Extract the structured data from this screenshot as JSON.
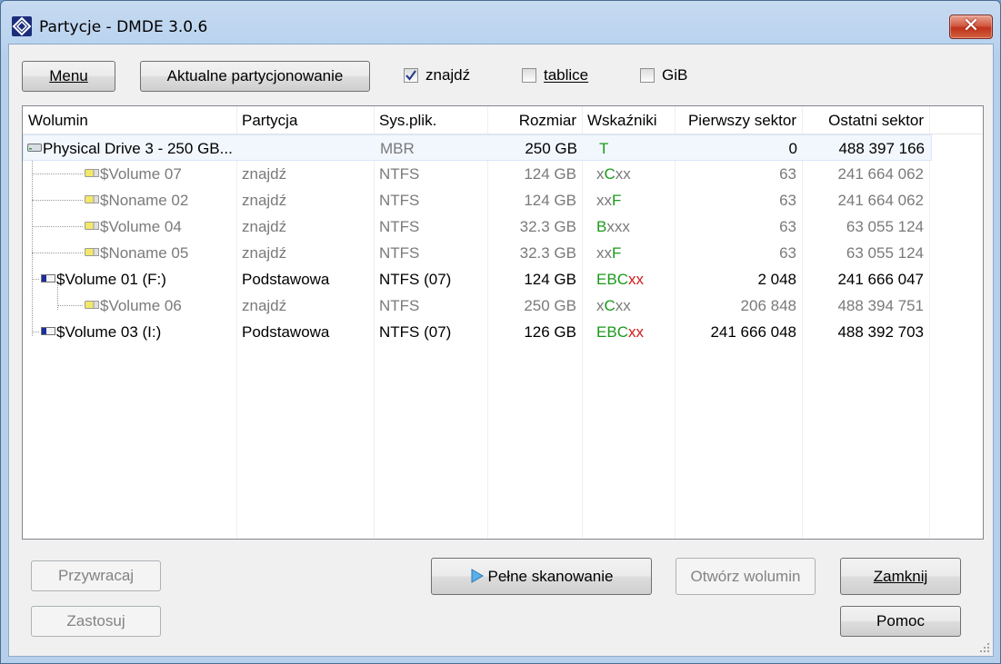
{
  "window": {
    "title": "Partycje - DMDE 3.0.6"
  },
  "toolbar": {
    "menu_label": "Menu",
    "current_partitioning_label": "Aktualne partycjonowanie",
    "checkbox_find": {
      "label": "znajdź",
      "checked": true
    },
    "checkbox_tables": {
      "label": "tablice",
      "checked": false
    },
    "checkbox_gib": {
      "label": "GiB",
      "checked": false
    }
  },
  "table": {
    "columns": [
      "Wolumin",
      "Partycja",
      "Sys.plik.",
      "Rozmiar",
      "Wskaźniki",
      "Pierwszy sektor",
      "Ostatni sektor"
    ],
    "rows": [
      {
        "name": "Physical Drive 3 - 250 GB...",
        "partition": "",
        "fs": "MBR",
        "size": "250 GB",
        "flags": "T",
        "first": "0",
        "last": "488 397 166"
      },
      {
        "name": "$Volume 07",
        "partition": "znajdź",
        "fs": "NTFS",
        "size": "124 GB",
        "flags": "xCxx",
        "first": "63",
        "last": "241 664 062"
      },
      {
        "name": "$Noname 02",
        "partition": "znajdź",
        "fs": "NTFS",
        "size": "124 GB",
        "flags": "xxF",
        "first": "63",
        "last": "241 664 062"
      },
      {
        "name": "$Volume 04",
        "partition": "znajdź",
        "fs": "NTFS",
        "size": "32.3 GB",
        "flags": "Bxxx",
        "first": "63",
        "last": "63 055 124"
      },
      {
        "name": "$Noname 05",
        "partition": "znajdź",
        "fs": "NTFS",
        "size": "32.3 GB",
        "flags": "xxF",
        "first": "63",
        "last": "63 055 124"
      },
      {
        "name": "$Volume 01 (F:)",
        "partition": "Podstawowa",
        "fs": "NTFS (07)",
        "size": "124 GB",
        "flags": "EBCxx",
        "first": "2 048",
        "last": "241 666 047"
      },
      {
        "name": "$Volume 06",
        "partition": "znajdź",
        "fs": "NTFS",
        "size": "250 GB",
        "flags": "xCxx",
        "first": "206 848",
        "last": "488 394 751"
      },
      {
        "name": "$Volume 03 (I:)",
        "partition": "Podstawowa",
        "fs": "NTFS (07)",
        "size": "126 GB",
        "flags": "EBCxx",
        "first": "241 666 048",
        "last": "488 392 703"
      }
    ]
  },
  "bottom": {
    "restore_label": "Przywracaj",
    "apply_label": "Zastosuj",
    "full_scan_label": "Pełne skanowanie",
    "open_volume_label": "Otwórz wolumin",
    "close_label": "Zamknij",
    "help_label": "Pomoc"
  },
  "colors": {
    "flag_green": "#1a9a1a",
    "flag_red": "#d41a1a",
    "selection": "#f2f7fd",
    "title_bar": "#bad3ef"
  }
}
